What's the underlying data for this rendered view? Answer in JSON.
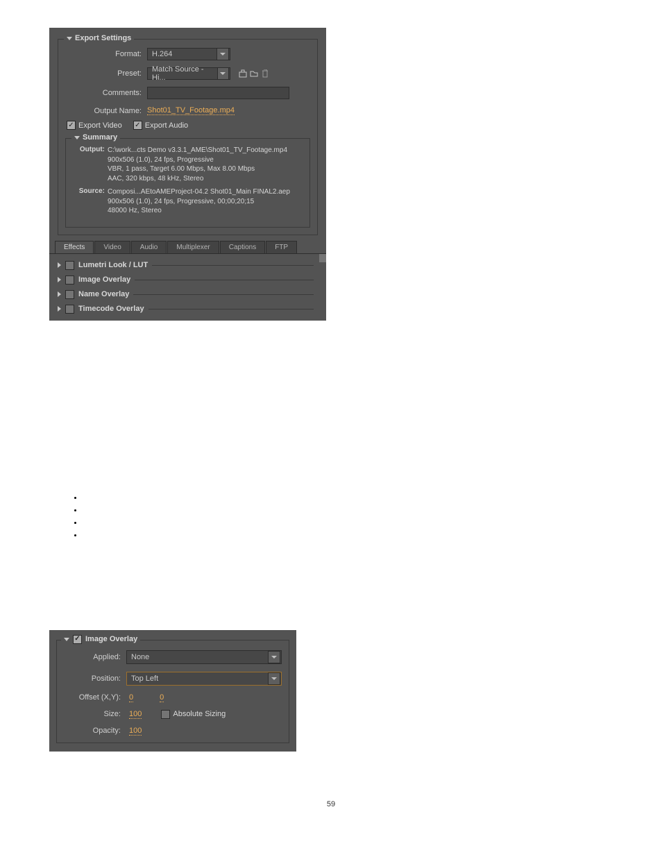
{
  "export": {
    "title": "Export Settings",
    "format_label": "Format:",
    "format_value": "H.264",
    "preset_label": "Preset:",
    "preset_value": "Match Source - Hi...",
    "comments_label": "Comments:",
    "output_label": "Output Name:",
    "output_value": "Shot01_TV_Footage.mp4",
    "export_video": "Export Video",
    "export_audio": "Export Audio"
  },
  "summary": {
    "title": "Summary",
    "output_key": "Output:",
    "output_l1": "C:\\work...cts Demo v3.3.1_AME\\Shot01_TV_Footage.mp4",
    "output_l2": "900x506 (1.0), 24 fps, Progressive",
    "output_l3": "VBR, 1 pass, Target 6.00 Mbps, Max 8.00 Mbps",
    "output_l4": "AAC, 320 kbps, 48 kHz, Stereo",
    "source_key": "Source:",
    "source_l1": "Composi...AEtoAMEProject-04.2 Shot01_Main FINAL2.aep",
    "source_l2": "900x506 (1.0), 24 fps, Progressive, 00;00;20;15",
    "source_l3": "48000 Hz, Stereo"
  },
  "tabs": {
    "effects": "Effects",
    "video": "Video",
    "audio": "Audio",
    "mux": "Multiplexer",
    "captions": "Captions",
    "ftp": "FTP"
  },
  "effects": {
    "lumetri": "Lumetri Look / LUT",
    "image": "Image Overlay",
    "name": "Name Overlay",
    "timecode": "Timecode Overlay"
  },
  "overlay": {
    "title": "Image Overlay",
    "applied_label": "Applied:",
    "applied_value": "None",
    "position_label": "Position:",
    "position_value": "Top Left",
    "offset_label": "Offset (X,Y):",
    "offset_x": "0",
    "offset_y": "0",
    "size_label": "Size:",
    "size_value": "100",
    "absolute": "Absolute Sizing",
    "opacity_label": "Opacity:",
    "opacity_value": "100"
  },
  "page_number": "59"
}
